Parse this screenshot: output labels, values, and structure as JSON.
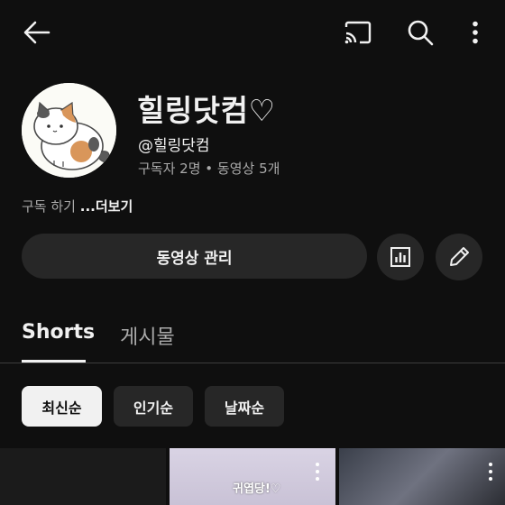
{
  "channel": {
    "name": "힐링닷컴♡",
    "handle": "@힐링닷컴",
    "stats": "구독자 2명 • 동영상 5개",
    "description": "구독 하기 ",
    "description_more": "...더보기"
  },
  "actions": {
    "manage_videos_label": "동영상 관리"
  },
  "tabs": [
    {
      "label": "Shorts",
      "selected": true
    },
    {
      "label": "게시물",
      "selected": false
    }
  ],
  "filter_chips": [
    {
      "label": "최신순",
      "selected": true
    },
    {
      "label": "인기순",
      "selected": false
    },
    {
      "label": "날짜순",
      "selected": false
    }
  ],
  "shorts": [
    {
      "caption": ""
    },
    {
      "caption": "귀엽당!♡"
    },
    {
      "caption": ""
    }
  ],
  "icons": {
    "back": "arrow-back-icon",
    "cast": "cast-icon",
    "search": "search-icon",
    "more": "more-vertical-icon",
    "analytics": "analytics-icon",
    "edit": "pencil-icon"
  },
  "colors": {
    "background": "#0f0f0f",
    "surface": "#272727",
    "text_primary": "#f1f1f1",
    "text_secondary": "#aaaaaa"
  }
}
